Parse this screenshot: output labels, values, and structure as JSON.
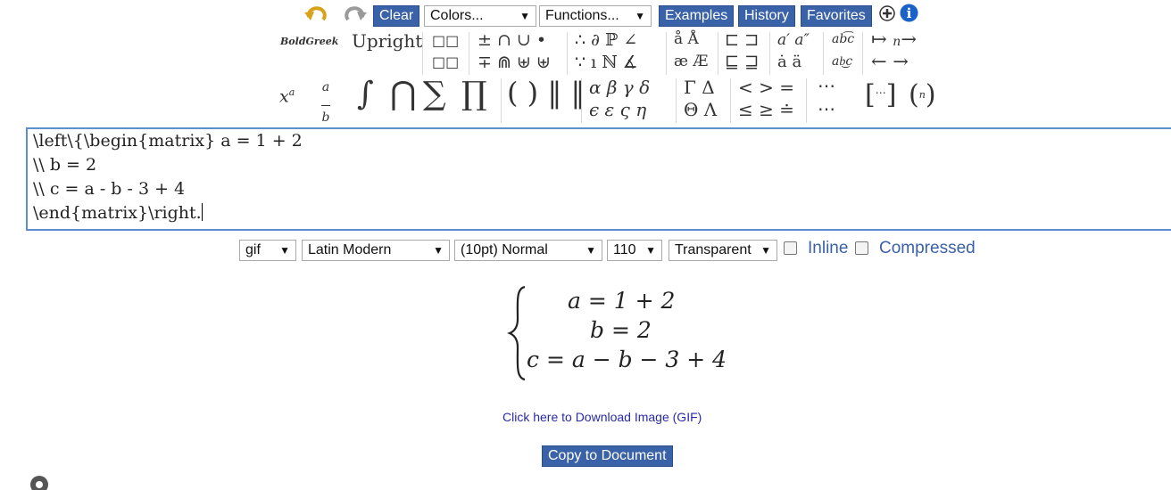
{
  "toolbar": {
    "clear_label": "Clear",
    "colors_select": "Colors...",
    "functions_select": "Functions...",
    "examples_label": "Examples",
    "history_label": "History",
    "favorites_label": "Favorites"
  },
  "symbols": {
    "boldgreek": "BoldGreek",
    "upright": "Upright"
  },
  "editor": {
    "lines": [
      "\\left\\{\\begin{matrix} a = 1 + 2",
      "\\\\ b = 2",
      "\\\\ c = a - b - 3 + 4",
      "\\end{matrix}\\right."
    ]
  },
  "options": {
    "format": "gif",
    "font": "Latin Modern",
    "size": "(10pt) Normal",
    "dpi": "110",
    "background": "Transparent",
    "inline_label": "Inline",
    "compressed_label": "Compressed"
  },
  "rendered": {
    "line1": "a = 1 + 2",
    "line2": "b = 2",
    "line3": "c = a − b − 3 + 4"
  },
  "download_link": "Click here to Download Image (GIF)",
  "copy_label": "Copy to Document",
  "colors": {
    "button": "#3a62a8",
    "editor_border": "#5b8fd0",
    "link": "#2a2aa8"
  }
}
